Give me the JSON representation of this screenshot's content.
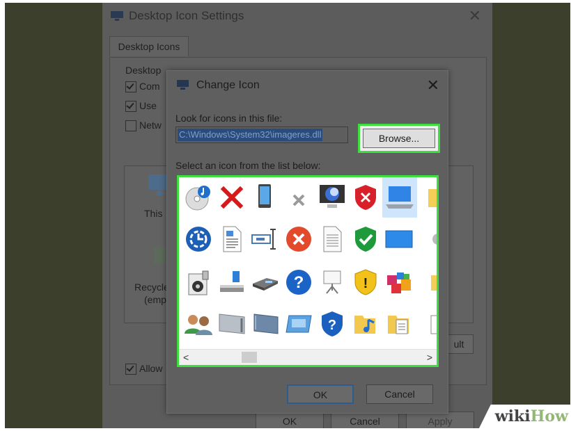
{
  "background_window": {
    "title": "Desktop Icon Settings",
    "tab": "Desktop Icons",
    "group_label": "Desktop",
    "checkboxes": [
      {
        "label": "Com",
        "checked": true
      },
      {
        "label": "Use",
        "checked": true
      },
      {
        "label": "Netw",
        "checked": false
      }
    ],
    "icon_labels": {
      "this_pc": "This",
      "recycle": "Recycle",
      "recycle_state": "(emp"
    },
    "allow_label": "Allow",
    "default_btn": "ult",
    "buttons": {
      "ok": "OK",
      "cancel": "Cancel",
      "apply": "Apply"
    }
  },
  "dialog": {
    "title": "Change Icon",
    "look_label": "Look for icons in this file:",
    "path_value": "C:\\Windows\\System32\\imageres.dll",
    "browse_label": "Browse...",
    "select_label": "Select an icon from the list below:",
    "ok_label": "OK",
    "cancel_label": "Cancel",
    "icons": [
      "cd-music-icon",
      "red-x-icon",
      "mobile-device-icon",
      "gray-x-icon",
      "monitor-icon",
      "shield-error-icon",
      "laptop-icon",
      "folder-partial-icon",
      "clock-dial-icon",
      "document-icon",
      "text-cursor-icon",
      "error-circle-icon",
      "blank-page-icon",
      "shield-check-icon",
      "display-blue-icon",
      "gear-partial-icon",
      "media-player-icon",
      "drive-icon",
      "scanner-icon",
      "help-icon",
      "projector-icon",
      "shield-warning-icon",
      "apps-cube-icon",
      "partial-icon",
      "users-icon",
      "drive-slot-icon",
      "drive-panel-icon",
      "card-icon",
      "shield-help-icon",
      "music-folder-icon",
      "document-folder-icon",
      "partial-doc-icon"
    ]
  },
  "colors": {
    "highlight": "#3fde3f",
    "selection": "#cfe5fb",
    "accent": "#1e66c8"
  },
  "watermark": {
    "part1": "wiki",
    "part2": "How"
  }
}
